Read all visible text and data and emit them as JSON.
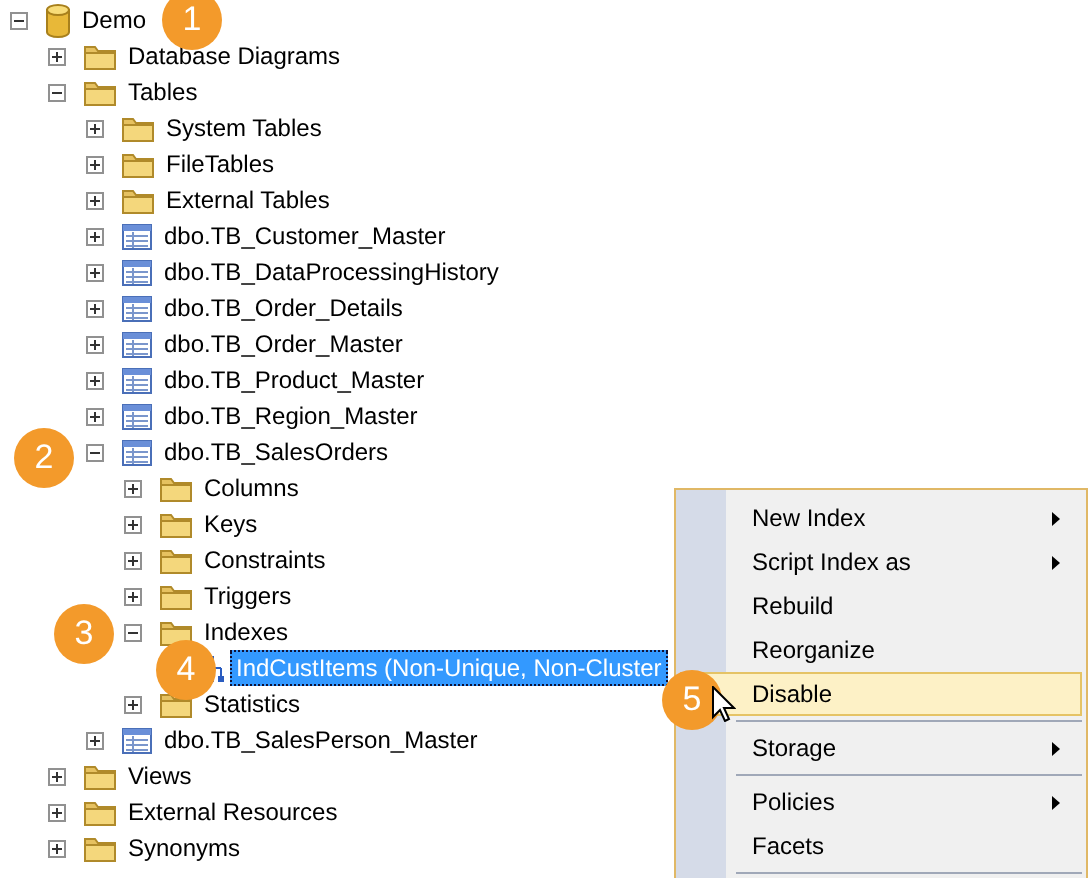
{
  "tree": [
    {
      "label": "Demo",
      "kind": "database",
      "expanded": true,
      "selected": false,
      "children": [
        {
          "label": "Database Diagrams",
          "kind": "folder",
          "expanded": false,
          "selected": false
        },
        {
          "label": "Tables",
          "kind": "folder",
          "expanded": true,
          "selected": false,
          "children": [
            {
              "label": "System Tables",
              "kind": "folder",
              "expanded": false,
              "selected": false
            },
            {
              "label": "FileTables",
              "kind": "folder",
              "expanded": false,
              "selected": false
            },
            {
              "label": "External Tables",
              "kind": "folder",
              "expanded": false,
              "selected": false
            },
            {
              "label": "dbo.TB_Customer_Master",
              "kind": "table",
              "expanded": false,
              "selected": false
            },
            {
              "label": "dbo.TB_DataProcessingHistory",
              "kind": "table",
              "expanded": false,
              "selected": false
            },
            {
              "label": "dbo.TB_Order_Details",
              "kind": "table",
              "expanded": false,
              "selected": false
            },
            {
              "label": "dbo.TB_Order_Master",
              "kind": "table",
              "expanded": false,
              "selected": false
            },
            {
              "label": "dbo.TB_Product_Master",
              "kind": "table",
              "expanded": false,
              "selected": false
            },
            {
              "label": "dbo.TB_Region_Master",
              "kind": "table",
              "expanded": false,
              "selected": false
            },
            {
              "label": "dbo.TB_SalesOrders",
              "kind": "table",
              "expanded": true,
              "selected": false,
              "children": [
                {
                  "label": "Columns",
                  "kind": "folder",
                  "expanded": false,
                  "selected": false
                },
                {
                  "label": "Keys",
                  "kind": "folder",
                  "expanded": false,
                  "selected": false
                },
                {
                  "label": "Constraints",
                  "kind": "folder",
                  "expanded": false,
                  "selected": false
                },
                {
                  "label": "Triggers",
                  "kind": "folder",
                  "expanded": false,
                  "selected": false
                },
                {
                  "label": "Indexes",
                  "kind": "folder",
                  "expanded": true,
                  "selected": false,
                  "children": [
                    {
                      "label": "IndCustItems (Non-Unique, Non-Cluster",
                      "kind": "index",
                      "selected": true
                    }
                  ]
                },
                {
                  "label": "Statistics",
                  "kind": "folder",
                  "expanded": false,
                  "selected": false
                }
              ]
            },
            {
              "label": "dbo.TB_SalesPerson_Master",
              "kind": "table",
              "expanded": false,
              "selected": false
            }
          ]
        },
        {
          "label": "Views",
          "kind": "folder",
          "expanded": false,
          "selected": false
        },
        {
          "label": "External Resources",
          "kind": "folder",
          "expanded": false,
          "selected": false
        },
        {
          "label": "Synonyms",
          "kind": "folder",
          "expanded": false,
          "selected": false
        }
      ]
    }
  ],
  "context_menu": [
    {
      "kind": "item",
      "label": "New Index",
      "submenu": true,
      "selected": false
    },
    {
      "kind": "item",
      "label": "Script Index as",
      "submenu": true,
      "selected": false
    },
    {
      "kind": "item",
      "label": "Rebuild",
      "submenu": false,
      "selected": false
    },
    {
      "kind": "item",
      "label": "Reorganize",
      "submenu": false,
      "selected": false
    },
    {
      "kind": "item",
      "label": "Disable",
      "submenu": false,
      "selected": true
    },
    {
      "kind": "separator"
    },
    {
      "kind": "item",
      "label": "Storage",
      "submenu": true,
      "selected": false
    },
    {
      "kind": "separator"
    },
    {
      "kind": "item",
      "label": "Policies",
      "submenu": true,
      "selected": false
    },
    {
      "kind": "item",
      "label": "Facets",
      "submenu": false,
      "selected": false
    },
    {
      "kind": "separator"
    }
  ],
  "callouts": [
    {
      "label": "1"
    },
    {
      "label": "2"
    },
    {
      "label": "3"
    },
    {
      "label": "4"
    },
    {
      "label": "5"
    }
  ]
}
